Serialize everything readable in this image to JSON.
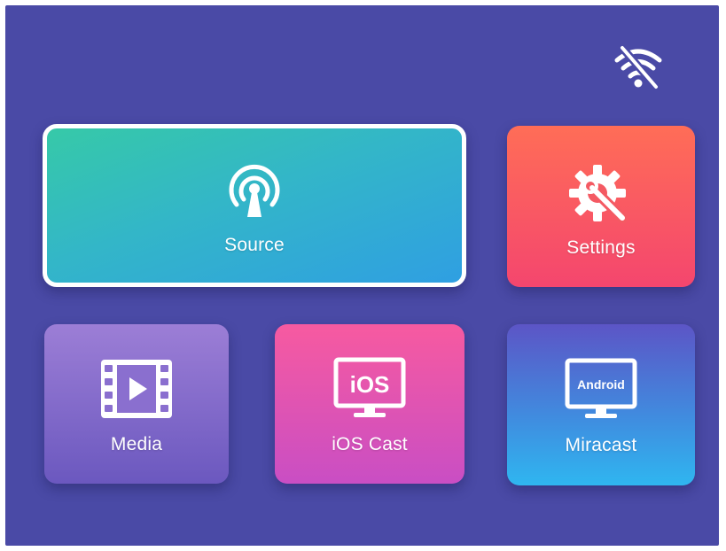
{
  "status": {
    "wifi_icon": "wifi-off-icon"
  },
  "tiles": {
    "source": {
      "label": "Source",
      "icon": "antenna-icon",
      "selected": true
    },
    "settings": {
      "label": "Settings",
      "icon": "gear-wrench-icon"
    },
    "media": {
      "label": "Media",
      "icon": "film-play-icon"
    },
    "ios_cast": {
      "label": "iOS Cast",
      "icon": "ios-monitor-icon",
      "icon_text": "iOS"
    },
    "miracast": {
      "label": "Miracast",
      "icon": "android-monitor-icon",
      "icon_text": "Android"
    }
  },
  "colors": {
    "background": "#4a4aa6",
    "source": "#33b6c8",
    "settings": "#f45a63",
    "media": "#8a6fcf",
    "ios_cast": "#e656ae",
    "miracast": "#3f8ee0"
  }
}
